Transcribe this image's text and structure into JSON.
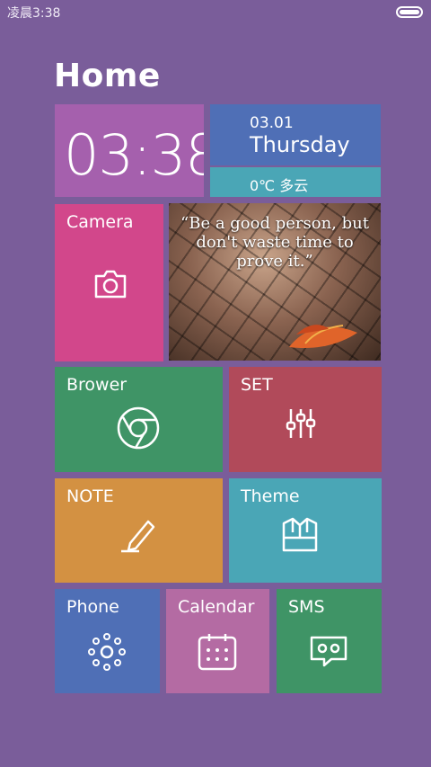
{
  "status_bar": {
    "time": "凌晨3:38",
    "battery_level": 1.0
  },
  "page": {
    "title": "Home"
  },
  "clock_tile": {
    "time": "03:38"
  },
  "date_tile": {
    "date": "03.01",
    "weekday": "Thursday"
  },
  "weather_tile": {
    "text": "0℃  多云"
  },
  "photo_tile": {
    "quote": "“Be a good person, but don't waste time to prove it.”"
  },
  "tiles": {
    "camera": {
      "label": "Camera",
      "icon": "camera-icon",
      "color": "#d2478b"
    },
    "browser": {
      "label": "Brower",
      "icon": "chrome-icon",
      "color": "#3f9466"
    },
    "set": {
      "label": "SET",
      "icon": "sliders-icon",
      "color": "#b14a5a"
    },
    "note": {
      "label": "NOTE",
      "icon": "pencil-icon",
      "color": "#d39142"
    },
    "theme": {
      "label": "Theme",
      "icon": "shirt-icon",
      "color": "#4aa6b6"
    },
    "phone": {
      "label": "Phone",
      "icon": "dialpad-icon",
      "color": "#4f6fb6"
    },
    "calendar": {
      "label": "Calendar",
      "icon": "calendar-icon",
      "color": "#b46ba3"
    },
    "sms": {
      "label": "SMS",
      "icon": "message-icon",
      "color": "#3f9466"
    }
  },
  "colors": {
    "background": "#7a5d9a",
    "clock": "#a560ad",
    "date": "#4f6fb6",
    "weather": "#4aa6b6"
  }
}
